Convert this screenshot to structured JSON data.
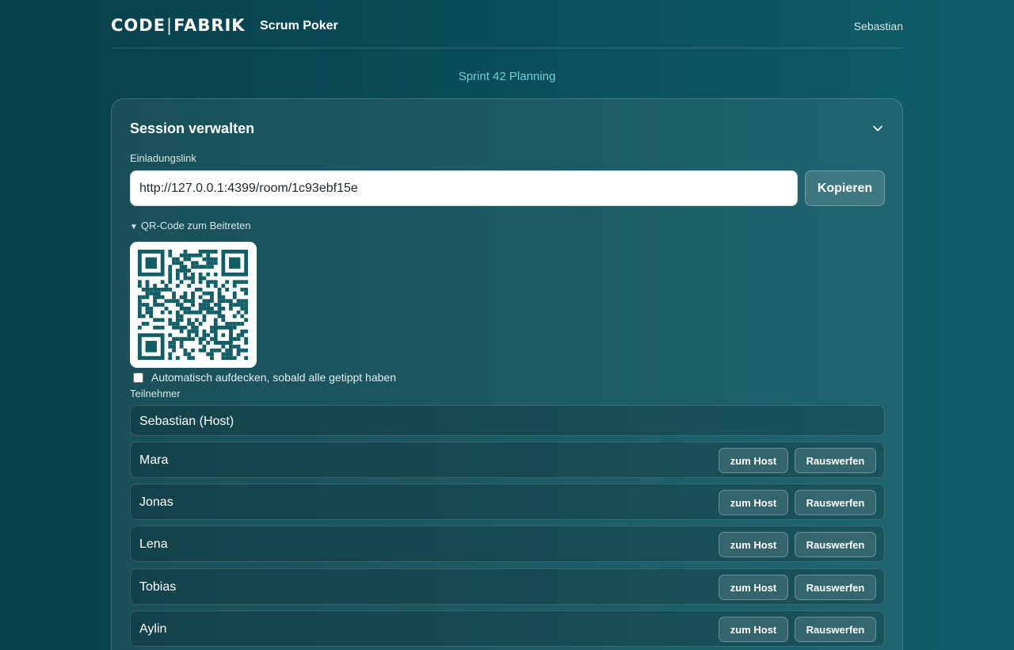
{
  "header": {
    "logo_left": "CODE",
    "logo_separator": "|",
    "logo_right": "FABRIK",
    "app_title": "Scrum Poker",
    "user_name": "Sebastian"
  },
  "session_name": "Sprint 42 Planning",
  "panel": {
    "title": "Session verwalten",
    "collapse_icon": "chevron-down-icon",
    "invite_label": "Einladungslink",
    "invite_value": "http://127.0.0.1:4399/room/1c93ebf15e",
    "copy_label": "Kopieren",
    "qr_toggle_label": "QR-Code zum Beitreten",
    "qr_color": "#125e66",
    "auto_reveal_label": "Automatisch aufdecken, sobald alle getippt haben",
    "auto_reveal_checked": false,
    "participants_label": "Teilnehmer"
  },
  "participants": [
    {
      "name": "Sebastian (Host)"
    },
    {
      "name": "Mara",
      "make_host_label": "zum Host",
      "kick_label": "Rauswerfen"
    },
    {
      "name": "Jonas",
      "make_host_label": "zum Host",
      "kick_label": "Rauswerfen"
    },
    {
      "name": "Lena",
      "make_host_label": "zum Host",
      "kick_label": "Rauswerfen"
    },
    {
      "name": "Tobias",
      "make_host_label": "zum Host",
      "kick_label": "Rauswerfen"
    },
    {
      "name": "Aylin",
      "make_host_label": "zum Host",
      "kick_label": "Rauswerfen"
    }
  ],
  "colors": {
    "background": "#0a4c57",
    "accent_text": "#6fd0dc"
  }
}
